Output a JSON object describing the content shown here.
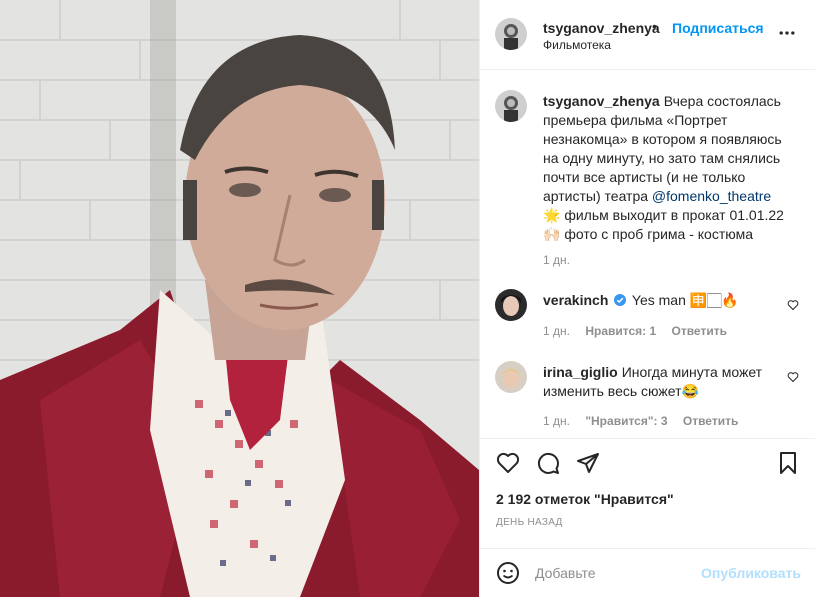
{
  "header": {
    "username": "tsyganov_zhenya",
    "separator": "•",
    "follow_label": "Подписаться",
    "location": "Фильмотека"
  },
  "caption": {
    "username": "tsyganov_zhenya",
    "text_before_mention": "Вчера состоялась премьера фильма «Портрет незнакомца» в котором я появляюсь на одну минуту, но зато там снялись почти все артисты (и не только артисты) театра ",
    "mention": "@fomenko_theatre",
    "line_film": "🌟 фильм выходит в прокат 01.01.22",
    "line_photo": "🙌🏻 фото с проб грима - костюма",
    "time": "1 дн."
  },
  "comments": [
    {
      "username": "verakinch",
      "text": "Yes man 🈸🏻🔥",
      "time": "1 дн.",
      "likes": "Нравится: 1",
      "reply": "Ответить"
    },
    {
      "username": "irina_giglio",
      "text": "Иногда минута может изменить весь сюжет😂",
      "time": "1 дн.",
      "likes": "\"Нравится\": 3",
      "reply": "Ответить"
    }
  ],
  "footer": {
    "likes": "2 192 отметок \"Нравится\"",
    "date": "День назад"
  },
  "comment_box": {
    "placeholder": "Добавьте",
    "post_label": "Опубликовать"
  },
  "icons": {
    "more": "more-horizontal-icon",
    "like": "heart-icon",
    "comment": "comment-icon",
    "share": "paper-plane-icon",
    "save": "bookmark-icon",
    "emoji": "emoji-icon",
    "verified": "verified-badge-icon"
  },
  "colors": {
    "accent": "#0095f6",
    "mention": "#00376b",
    "muted": "#8e8e8e",
    "post_disabled": "#b2dffc"
  }
}
